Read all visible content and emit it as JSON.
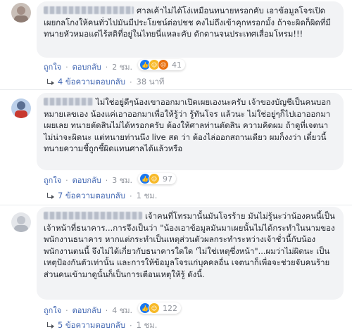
{
  "comments": [
    {
      "text": "ศาลเค้าไม่ได้โง่เหมือนทนายหรอกคับ เอาข้อมูลโจรเปิดเผยกลโกงให้คนทั่วไปมันมีประโยชน์ต่อปชช คงไม่ถึงเข้าคุกหรอกมั้ง ถ้าจะผิดก็ผิดที่มีทนายหัวหมอแต่ไร้สติที่อยู่ในไทยนี่แหละคับ ดักดานจนประเทศเสื่อมโทรม!!!",
      "like_label": "ถูกใจ",
      "reply_label": "ตอบกลับ",
      "reaction_count": "41",
      "time": "2 ชม.",
      "replies_label": "4 ข้อความตอบกลับ",
      "replies_time": "38 นาที"
    },
    {
      "text": "ไม่ใช่อยู่ดีๆน้องเขาออกมาเปิดเผยเองนะครับ เจ้าของบัญชีเป็นคนบอกหมายเลขเอง น้องแค่เอาออกมาเพื่อให้รู้ว่า รู้ทันโจร แล้วนะ ไม่ใช่อยู่ๆก็ไปเอาออกมาเผยเลย ทนายตัดสินไม่ได้หรอกครับ ต้องให้ศาลท่านตัดสิน ความคิดผม ถ้าดูที่เจตนาไม่น่าจะผิดนะ แต่ทนายท่านนึง live สด ว่า ต้องไล่ออกสถานเดียว ผมก็งงว่า เดี๋ยวนี้ทนายความชี้ถูกชี้ผิดแทนศาลได้แล้วหรือ",
      "like_label": "ถูกใจ",
      "reply_label": "ตอบกลับ",
      "reaction_count": "97",
      "time": "3 ชม.",
      "replies_label": "7 ข้อความตอบกลับ",
      "replies_time": "1 ชม."
    },
    {
      "text": "เจ้าคนที่โทรมานั้นมันโจรร้าย มันไม่รู้นะว่าน้องคนนี้เป็นเจ้าหน้าที่ธนาคาร...การจึงเป็นว่า \"น้องเอาข้อมูลมันมาเผยนั้นไม่ได้กระทำในนามของพนักงานธนาคาร หากแต่กระทำเป็นเหตุส่วนตัวผลกระทำระหว่างเจ้าชั่วนี้กับน้องพนักงานตนนี้ จึงไม่ได้เกี่ยวกับธนาคารใดใด 'ไม่ใช่เหตุซึ่งหน้า\"...ผมว่าไม่ผิดนะ เป็นเหตุป้องกันตัวเท่านั้น และการให้ข้อมูลโจรแก่บุคคลอื่น เจตนาก็เพื่อจะช่วยจับคนร้าย ส่วนคนเข้ามาดูนั้นก็เป็นการเตือนเหตุให้รู้ ดังนี้.",
      "like_label": "ถูกใจ",
      "reply_label": "ตอบกลับ",
      "reaction_count": "122",
      "time": "4 ชม.",
      "replies_label": "5 ข้อความตอบกลับ",
      "replies_time": "1 ชม."
    }
  ],
  "colors": {
    "link": "#4267b2",
    "bubble": "#f2f3f5",
    "meta": "#90949c"
  },
  "icons": [
    "like-icon",
    "haha-icon",
    "angry-icon",
    "reply-arrow-icon"
  ]
}
